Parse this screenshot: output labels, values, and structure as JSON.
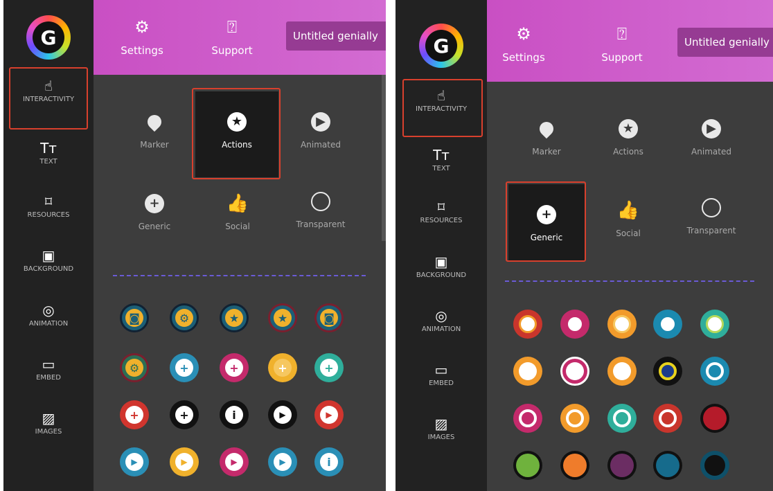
{
  "left_panel": {
    "logo_letter": "G",
    "sidebar": [
      {
        "label": "INTERACTIVITY",
        "icon": "tap-hand-icon"
      },
      {
        "label": "TEXT",
        "icon": "text-icon",
        "glyph": "Tт"
      },
      {
        "label": "RESOURCES",
        "icon": "resources-icon"
      },
      {
        "label": "BACKGROUND",
        "icon": "background-icon"
      },
      {
        "label": "ANIMATION",
        "icon": "animation-icon"
      },
      {
        "label": "EMBED",
        "icon": "embed-icon"
      },
      {
        "label": "IMAGES",
        "icon": "images-icon"
      }
    ],
    "top": {
      "settings": "Settings",
      "support": "Support",
      "title": "Untitled genially"
    },
    "tiles": [
      {
        "label": "Marker",
        "icon": "marker-icon"
      },
      {
        "label": "Actions",
        "icon": "star-icon",
        "selected": true
      },
      {
        "label": "Animated",
        "icon": "play-icon"
      },
      {
        "label": "Generic",
        "icon": "plus-icon"
      },
      {
        "label": "Social",
        "icon": "thumbs-up-icon"
      },
      {
        "label": "Transparent",
        "icon": "circle-icon"
      }
    ],
    "buttons": [
      [
        "camera",
        "gear",
        "star",
        "star",
        "camera"
      ],
      [
        "gear",
        "plus",
        "plus",
        "plus",
        "plus"
      ],
      [
        "plus",
        "plus",
        "info",
        "play",
        "play"
      ],
      [
        "play",
        "play",
        "play",
        "play",
        "info"
      ]
    ]
  },
  "right_panel": {
    "logo_letter": "G",
    "sidebar": [
      {
        "label": "INTERACTIVITY",
        "icon": "tap-hand-icon"
      },
      {
        "label": "TEXT",
        "icon": "text-icon",
        "glyph": "Tт"
      },
      {
        "label": "RESOURCES",
        "icon": "resources-icon"
      },
      {
        "label": "BACKGROUND",
        "icon": "background-icon"
      },
      {
        "label": "ANIMATION",
        "icon": "animation-icon"
      },
      {
        "label": "EMBED",
        "icon": "embed-icon"
      },
      {
        "label": "IMAGES",
        "icon": "images-icon"
      }
    ],
    "top": {
      "settings": "Settings",
      "support": "Support",
      "title": "Untitled genially"
    },
    "tiles": [
      {
        "label": "Marker",
        "icon": "marker-icon"
      },
      {
        "label": "Actions",
        "icon": "star-icon"
      },
      {
        "label": "Animated",
        "icon": "play-icon"
      },
      {
        "label": "Generic",
        "icon": "plus-icon",
        "selected": true
      },
      {
        "label": "Social",
        "icon": "thumbs-up-icon"
      },
      {
        "label": "Transparent",
        "icon": "circle-icon"
      }
    ]
  },
  "colors": {
    "accent": "#c94fc3",
    "highlight": "#d9402d",
    "sidebar": "#222222",
    "panel": "#3d3d3d"
  }
}
